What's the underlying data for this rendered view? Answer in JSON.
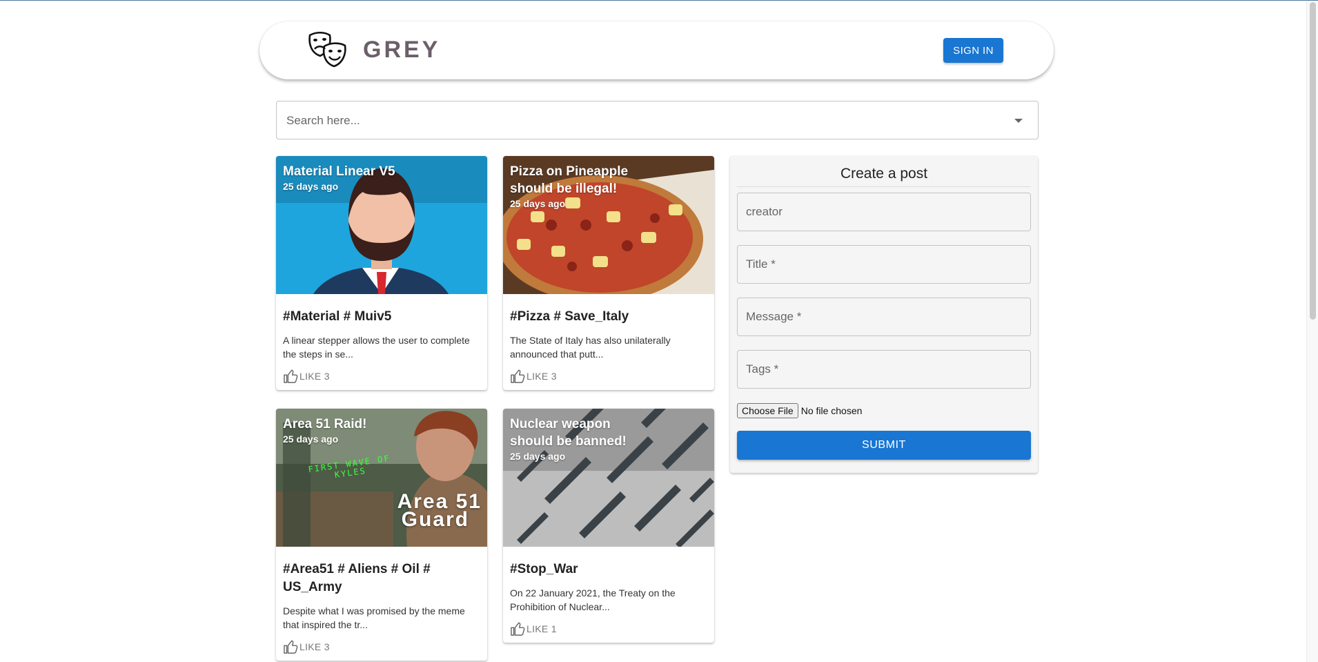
{
  "header": {
    "brand": "GREY",
    "logo_icon": "theater-masks-icon",
    "signin_label": "SIGN IN"
  },
  "search": {
    "placeholder": "Search here..."
  },
  "posts": [
    {
      "title": "Material Linear V5",
      "time": "25 days ago",
      "tags": "#Material # Muiv5",
      "message": "A linear stepper allows the user to complete the steps in se...",
      "like": "LIKE 3"
    },
    {
      "title": "Pizza on Pineapple should be illegal!",
      "time": "25 days ago",
      "tags": "#Pizza # Save_Italy",
      "message": "The State of Italy has also unilaterally announced that putt...",
      "like": "LIKE 3"
    },
    {
      "title": "Area 51 Raid!",
      "time": "25 days ago",
      "tags": "#Area51 # Aliens # Oil # US_Army",
      "message": "Despite what I was promised by the meme that inspired the tr...",
      "like": "LIKE 3",
      "image_text": {
        "caption_line1": "FIRST WAVE OF",
        "caption_line2": "KYLES",
        "badge_line1": "Area 51",
        "badge_line2": "Guard"
      }
    },
    {
      "title": "Nuclear weapon should be banned!",
      "time": "25 days ago",
      "tags": "#Stop_War",
      "message": "On 22 January 2021, the Treaty on the Prohibition of Nuclear...",
      "like": "LIKE 1"
    }
  ],
  "form": {
    "heading": "Create a post",
    "creator_placeholder": "creator",
    "title_placeholder": "Title *",
    "message_placeholder": "Message *",
    "tags_placeholder": "Tags *",
    "file_button": "Choose File",
    "file_status": "No file chosen",
    "submit_label": "SUBMIT"
  },
  "colors": {
    "primary": "#1976d2",
    "brand_text": "#6b5f6a"
  }
}
